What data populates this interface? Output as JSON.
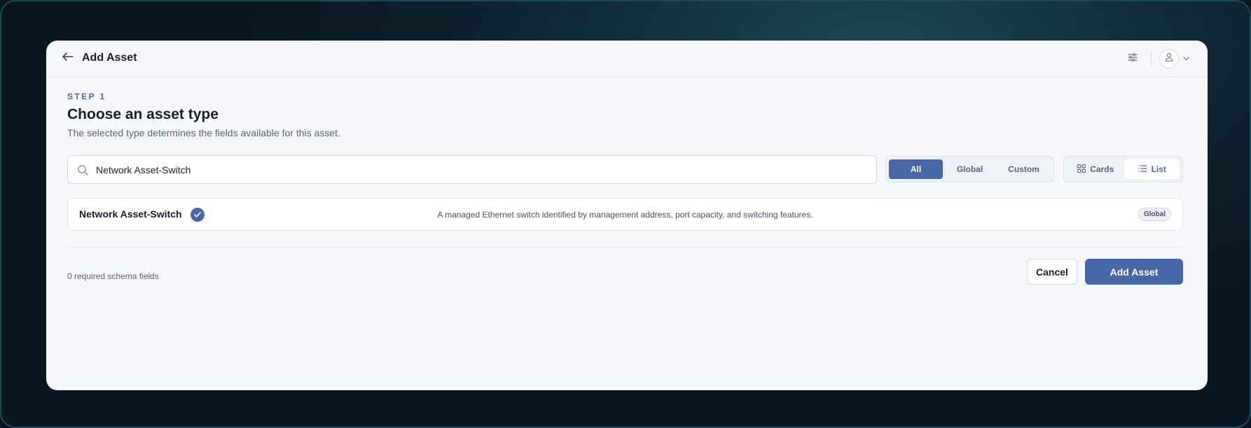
{
  "header": {
    "title": "Add Asset",
    "back_icon": "arrow-left-icon",
    "settings_icon": "sliders-icon",
    "avatar_icon": "user-icon",
    "chevron_icon": "chevron-down-icon"
  },
  "step": {
    "label": "STEP 1",
    "heading": "Choose an asset type",
    "description": "The selected type determines the fields available for this asset."
  },
  "search": {
    "value": "Network Asset-Switch",
    "icon": "search-icon"
  },
  "filter_tabs": {
    "selected": "All",
    "items": [
      "All",
      "Global",
      "Custom"
    ]
  },
  "view_toggle": {
    "selected": "List",
    "items": [
      {
        "label": "Cards",
        "icon": "grid-icon"
      },
      {
        "label": "List",
        "icon": "list-icon"
      }
    ]
  },
  "results": [
    {
      "name": "Network Asset-Switch",
      "selected": true,
      "description": "A managed Ethernet switch identified by management address, port capacity, and switching features.",
      "badge": "Global"
    }
  ],
  "footer": {
    "required_fields": "0 required schema fields",
    "cancel_label": "Cancel",
    "submit_label": "Add Asset"
  },
  "colors": {
    "accent": "#4867a6",
    "background": "#0c1f2b",
    "card": "#f5f7fa"
  }
}
